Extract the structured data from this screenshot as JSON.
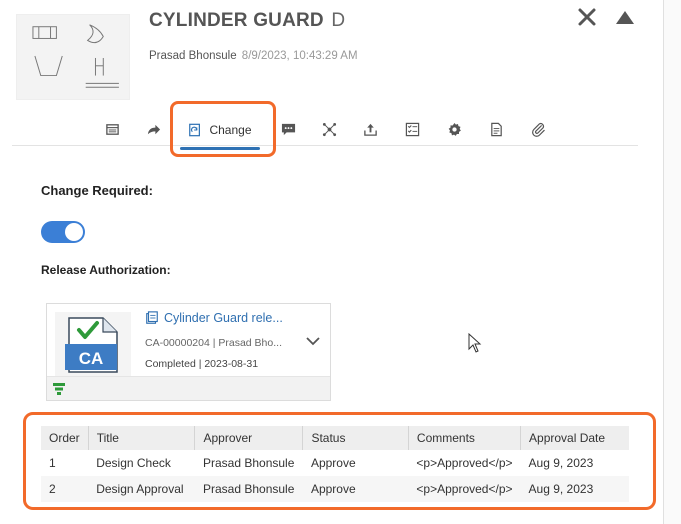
{
  "header": {
    "title": "CYLINDER GUARD",
    "revision": "D",
    "author": "Prasad Bhonsule",
    "timestamp": "8/9/2023, 10:43:29 AM",
    "close_icon": "close-icon",
    "collapse_icon": "collapse-up-icon"
  },
  "tabs": {
    "items": [
      {
        "icon": "details-icon"
      },
      {
        "icon": "share-arrow-icon"
      },
      {
        "icon": "change-icon",
        "label": "Change",
        "active": true
      },
      {
        "icon": "comments-icon"
      },
      {
        "icon": "structure-icon"
      },
      {
        "icon": "upload-icon"
      },
      {
        "icon": "checklist-icon"
      },
      {
        "icon": "settings-icon"
      },
      {
        "icon": "document-icon"
      },
      {
        "icon": "attachment-icon"
      }
    ],
    "active_label": "Change"
  },
  "change": {
    "required_label": "Change Required:",
    "required_value": true,
    "release_label": "Release Authorization:"
  },
  "card": {
    "title": "Cylinder Guard rele...",
    "subtitle": "CA-00000204 | Prasad Bho...",
    "status": "Completed | 2023-08-31",
    "icon_text": "CA"
  },
  "approvals": {
    "columns": [
      "Order",
      "Title",
      "Approver",
      "Status",
      "Comments",
      "Approval Date"
    ],
    "rows": [
      [
        "1",
        "Design Check",
        "Prasad Bhonsule",
        "Approve",
        "<p>Approved</p>",
        "Aug 9, 2023"
      ],
      [
        "2",
        "Design Approval",
        "Prasad Bhonsule",
        "Approve",
        "<p>Approved</p>",
        "Aug 9, 2023"
      ]
    ]
  },
  "colors": {
    "accent": "#2f72b4",
    "highlight": "#f26a2a",
    "toggle": "#3b7fd6"
  }
}
